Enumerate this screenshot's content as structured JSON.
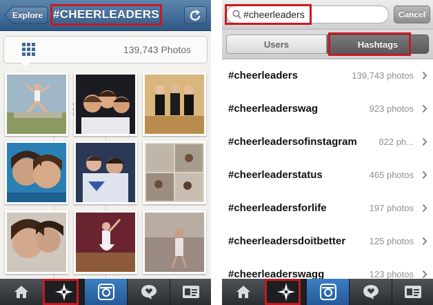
{
  "left": {
    "header": {
      "back_label": "Explore",
      "title": "#CHEERLEADERS"
    },
    "toolbar": {
      "photo_count": "139,743 Photos",
      "views": [
        "grid-view",
        "list-view"
      ]
    },
    "photo_grid": {
      "rows": 3,
      "columns": 3,
      "count": 9
    },
    "tabbar": {
      "items": [
        "home-icon",
        "explore-icon",
        "camera-icon",
        "activity-icon",
        "profile-icon"
      ],
      "active": "explore"
    }
  },
  "right": {
    "search": {
      "value": "#cheerleaders"
    },
    "cancel_label": "Cancel",
    "segments": {
      "users": "Users",
      "hashtags": "Hashtags",
      "active": "hashtags"
    },
    "results": [
      {
        "tag": "#cheerleaders",
        "count": "139,743 photos"
      },
      {
        "tag": "#cheerleaderswag",
        "count": "923 photos"
      },
      {
        "tag": "#cheerleadersofinstagram",
        "count": "822 ph..."
      },
      {
        "tag": "#cheerleaderstatus",
        "count": "465 photos"
      },
      {
        "tag": "#cheerleadersforlife",
        "count": "197 photos"
      },
      {
        "tag": "#cheerleadersdoitbetter",
        "count": "125 photos"
      },
      {
        "tag": "#cheerleaderswagg",
        "count": "123 photos"
      }
    ],
    "tabbar": {
      "items": [
        "home-icon",
        "explore-icon",
        "camera-icon",
        "activity-icon",
        "profile-icon"
      ],
      "active": "explore"
    }
  },
  "colors": {
    "header_blue": "#3f6b96",
    "highlight_red": "#c61a23",
    "active_tab_blue": "#2f6aa8",
    "tabbar_dark": "#35383b"
  }
}
